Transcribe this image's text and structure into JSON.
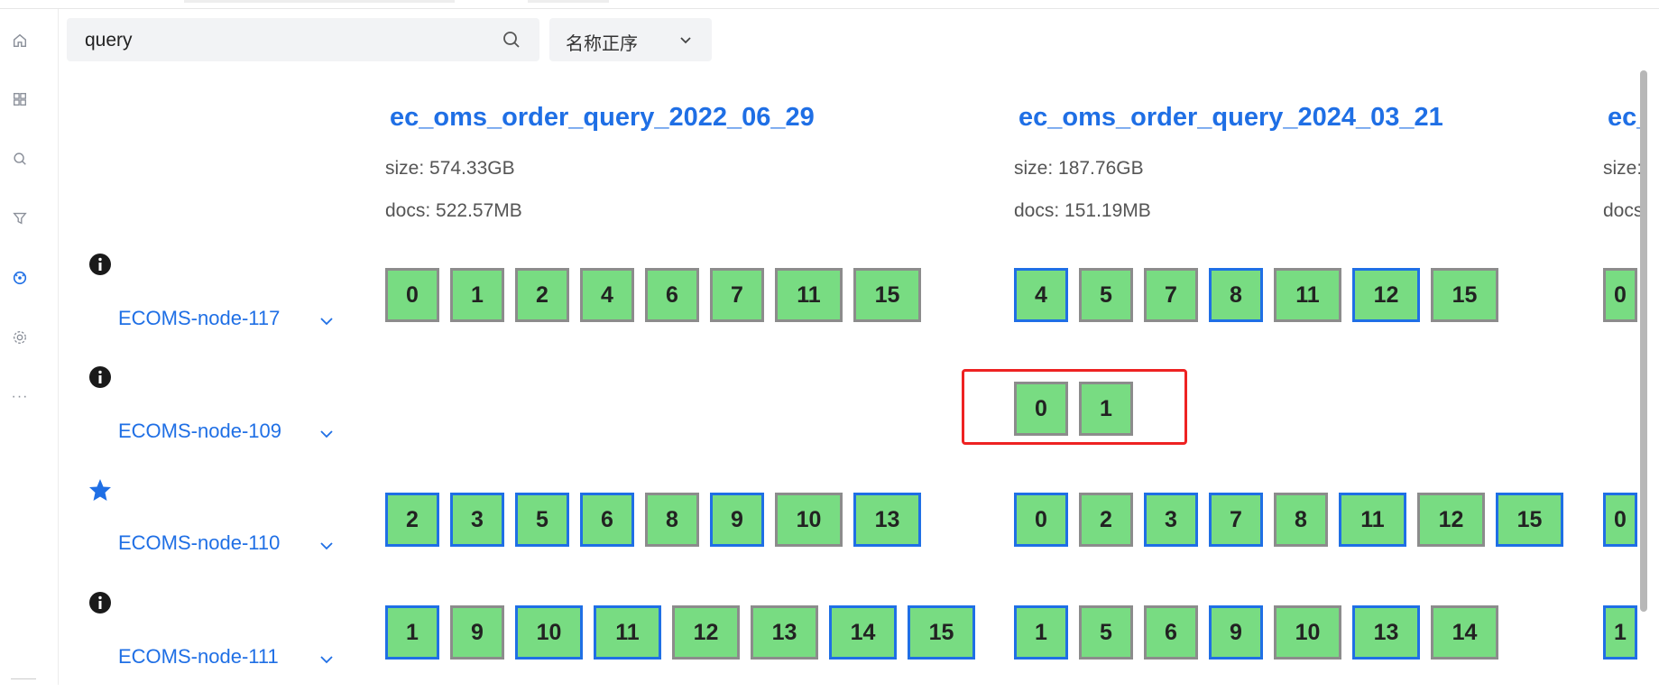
{
  "search": {
    "value": "query",
    "placeholder": ""
  },
  "sort": {
    "selected": "名称正序"
  },
  "nav": {
    "icons": [
      "home-icon",
      "dashboard-icon",
      "search-icon",
      "filter-icon",
      "cluster-icon",
      "settings-icon",
      "more-icon"
    ],
    "active": "cluster-icon"
  },
  "nodes": [
    {
      "name": "ECOMS-node-117",
      "status": "info"
    },
    {
      "name": "ECOMS-node-109",
      "status": "info"
    },
    {
      "name": "ECOMS-node-110",
      "status": "master"
    },
    {
      "name": "ECOMS-node-111",
      "status": "info"
    }
  ],
  "indices": [
    {
      "name": "ec_oms_order_query_2022_06_29",
      "size": "size: 574.33GB",
      "docs": "docs: 522.57MB",
      "shards": [
        [
          {
            "n": "0",
            "p": false
          },
          {
            "n": "1",
            "p": false
          },
          {
            "n": "2",
            "p": false
          },
          {
            "n": "4",
            "p": false
          },
          {
            "n": "6",
            "p": false
          },
          {
            "n": "7",
            "p": false
          },
          {
            "n": "11",
            "p": false
          },
          {
            "n": "15",
            "p": false
          }
        ],
        [],
        [
          {
            "n": "2",
            "p": true
          },
          {
            "n": "3",
            "p": true
          },
          {
            "n": "5",
            "p": true
          },
          {
            "n": "6",
            "p": true
          },
          {
            "n": "8",
            "p": false
          },
          {
            "n": "9",
            "p": true
          },
          {
            "n": "10",
            "p": false
          },
          {
            "n": "13",
            "p": true
          }
        ],
        [
          {
            "n": "1",
            "p": true
          },
          {
            "n": "9",
            "p": false
          },
          {
            "n": "10",
            "p": true
          },
          {
            "n": "11",
            "p": true
          },
          {
            "n": "12",
            "p": false
          },
          {
            "n": "13",
            "p": false
          },
          {
            "n": "14",
            "p": true
          },
          {
            "n": "15",
            "p": true
          }
        ]
      ]
    },
    {
      "name": "ec_oms_order_query_2024_03_21",
      "size": "size: 187.76GB",
      "docs": "docs: 151.19MB",
      "shards": [
        [
          {
            "n": "4",
            "p": true
          },
          {
            "n": "5",
            "p": false
          },
          {
            "n": "7",
            "p": false
          },
          {
            "n": "8",
            "p": true
          },
          {
            "n": "11",
            "p": false
          },
          {
            "n": "12",
            "p": true
          },
          {
            "n": "15",
            "p": false
          }
        ],
        [
          {
            "n": "0",
            "p": false
          },
          {
            "n": "1",
            "p": false
          }
        ],
        [
          {
            "n": "0",
            "p": true
          },
          {
            "n": "2",
            "p": false
          },
          {
            "n": "3",
            "p": true
          },
          {
            "n": "7",
            "p": true
          },
          {
            "n": "8",
            "p": false
          },
          {
            "n": "11",
            "p": true
          },
          {
            "n": "12",
            "p": false
          },
          {
            "n": "15",
            "p": true
          }
        ],
        [
          {
            "n": "1",
            "p": true
          },
          {
            "n": "5",
            "p": false
          },
          {
            "n": "6",
            "p": false
          },
          {
            "n": "9",
            "p": true
          },
          {
            "n": "10",
            "p": false
          },
          {
            "n": "13",
            "p": true
          },
          {
            "n": "14",
            "p": false
          }
        ]
      ]
    },
    {
      "name": "ec_",
      "size": "size:",
      "docs": "docs:",
      "shards": [
        [
          {
            "n": "0",
            "p": false
          }
        ],
        [],
        [
          {
            "n": "0",
            "p": true
          }
        ],
        [
          {
            "n": "1",
            "p": true
          }
        ]
      ]
    }
  ],
  "colors": {
    "accent": "#1f6fe5",
    "shard_fill": "#78dc82",
    "replica_border": "#8c8c8c",
    "highlight": "#ee2222"
  }
}
